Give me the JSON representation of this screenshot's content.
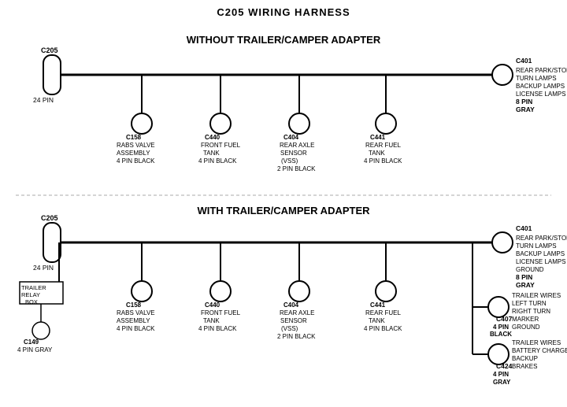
{
  "title": "C205 WIRING HARNESS",
  "section1": {
    "label": "WITHOUT TRAILER/CAMPER ADAPTER",
    "left_connector": {
      "id": "C205",
      "pins": "24 PIN"
    },
    "right_connector": {
      "id": "C401",
      "pins": "8 PIN",
      "color": "GRAY",
      "desc": "REAR PARK/STOP\nTURN LAMPS\nBACKUP LAMPS\nLICENSE LAMPS"
    },
    "connectors": [
      {
        "id": "C158",
        "desc": "RABS VALVE\nASSEMBLY\n4 PIN BLACK"
      },
      {
        "id": "C440",
        "desc": "FRONT FUEL\nTANK\n4 PIN BLACK"
      },
      {
        "id": "C404",
        "desc": "REAR AXLE\nSENSOR\n(VSS)\n2 PIN BLACK"
      },
      {
        "id": "C441",
        "desc": "REAR FUEL\nTANK\n4 PIN BLACK"
      }
    ]
  },
  "section2": {
    "label": "WITH TRAILER/CAMPER ADAPTER",
    "left_connector": {
      "id": "C205",
      "pins": "24 PIN"
    },
    "right_connector": {
      "id": "C401",
      "pins": "8 PIN",
      "color": "GRAY",
      "desc": "REAR PARK/STOP\nTURN LAMPS\nBACKUP LAMPS\nLICENSE LAMPS\nGROUND"
    },
    "connectors": [
      {
        "id": "C158",
        "desc": "RABS VALVE\nASSEMBLY\n4 PIN BLACK"
      },
      {
        "id": "C440",
        "desc": "FRONT FUEL\nTANK\n4 PIN BLACK"
      },
      {
        "id": "C404",
        "desc": "REAR AXLE\nSENSOR\n(VSS)\n2 PIN BLACK"
      },
      {
        "id": "C441",
        "desc": "REAR FUEL\nTANK\n4 PIN BLACK"
      }
    ],
    "trailer_relay": {
      "id": "TRAILER\nRELAY\nBOX",
      "sub": "C149\n4 PIN GRAY"
    },
    "right_extra": [
      {
        "id": "C407",
        "pins": "4 PIN\nBLACK",
        "desc": "TRAILER WIRES\nLEFT TURN\nRIGHT TURN\nMARKER\nGROUND"
      },
      {
        "id": "C424",
        "pins": "4 PIN\nGRAY",
        "desc": "TRAILER WIRES\nBATTERY CHARGE\nBACKUP\nBRAKES"
      }
    ]
  }
}
